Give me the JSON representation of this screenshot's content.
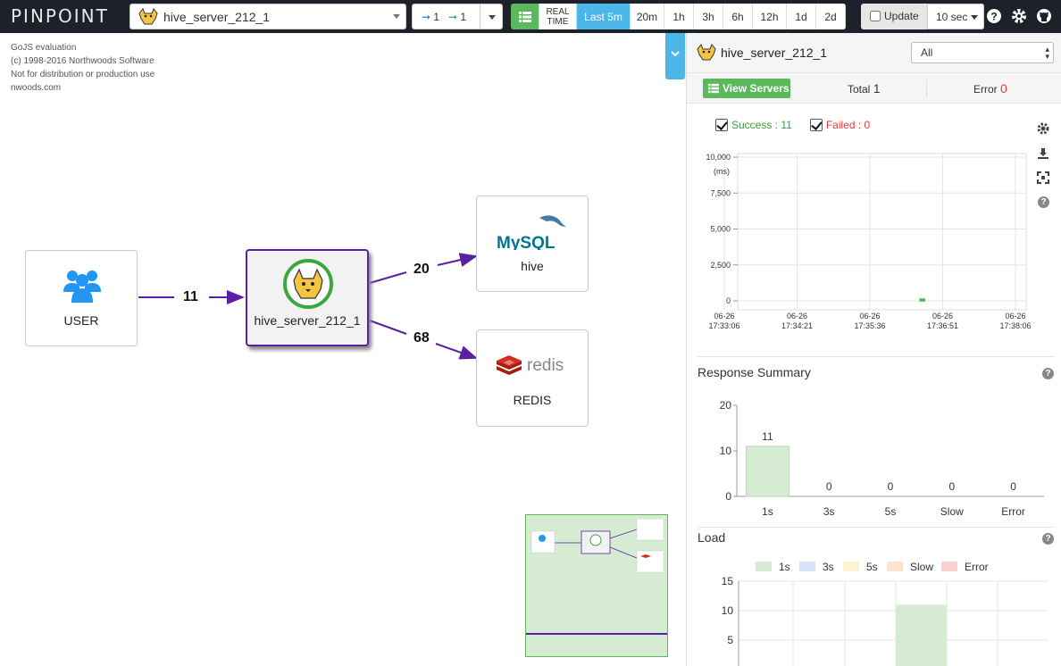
{
  "brand": "PINPOINT",
  "app_selector": {
    "value": "hive_server_212_1"
  },
  "depth": {
    "inbound": "1",
    "outbound": "1"
  },
  "time_range": {
    "real_time": "REAL TIME",
    "options": [
      "Last 5m",
      "20m",
      "1h",
      "3h",
      "6h",
      "12h",
      "1d",
      "2d"
    ],
    "selected": "Last 5m"
  },
  "update": {
    "label": "Update",
    "interval": "10 sec"
  },
  "gojs_notice": [
    "GoJS evaluation",
    "(c) 1998-2016 Northwoods Software",
    "Not for distribution or production use",
    "nwoods.com"
  ],
  "servermap": {
    "nodes": {
      "user": "USER",
      "main": "hive_server_212_1",
      "mysql": "hive",
      "mysql_logo": "MySQL",
      "redis": "REDIS",
      "redis_logo": "redis"
    },
    "edges": {
      "user_to_main": "11",
      "main_to_mysql": "20",
      "main_to_redis": "68"
    }
  },
  "panel": {
    "app_name": "hive_server_212_1",
    "filter": "All",
    "view_servers": "View Servers",
    "total_label": "Total",
    "total_value": "1",
    "error_label": "Error",
    "error_value": "0",
    "scatter": {
      "success_label": "Success : 11",
      "failed_label": "Failed : 0",
      "y_ticks": [
        "10,000",
        "7,500",
        "5,000",
        "2,500",
        "0"
      ],
      "y_unit": "(ms)",
      "x_ticks": [
        [
          "06-26",
          "17:33:06"
        ],
        [
          "06-26",
          "17:34:21"
        ],
        [
          "06-26",
          "17:35:36"
        ],
        [
          "06-26",
          "17:36:51"
        ],
        [
          "06-26",
          "17:38:06"
        ]
      ]
    },
    "response_summary": {
      "title": "Response Summary",
      "categories": [
        "1s",
        "3s",
        "5s",
        "Slow",
        "Error"
      ],
      "values": [
        11,
        0,
        0,
        0,
        0
      ],
      "y_ticks": [
        "20",
        "10",
        "0"
      ]
    },
    "load": {
      "title": "Load",
      "legend": [
        "1s",
        "3s",
        "5s",
        "Slow",
        "Error"
      ],
      "y_ticks": [
        "15",
        "10",
        "5"
      ]
    }
  },
  "chart_data": [
    {
      "type": "scatter",
      "title": "",
      "ylabel": "(ms)",
      "ylim": [
        0,
        10000
      ],
      "x_range": [
        "17:33:06",
        "17:38:06"
      ],
      "series": [
        {
          "name": "Success : 11",
          "points": [
            {
              "x": "17:36:30",
              "y": 0
            }
          ]
        },
        {
          "name": "Failed : 0",
          "points": []
        }
      ]
    },
    {
      "type": "bar",
      "title": "Response Summary",
      "categories": [
        "1s",
        "3s",
        "5s",
        "Slow",
        "Error"
      ],
      "values": [
        11,
        0,
        0,
        0,
        0
      ],
      "ylim": [
        0,
        20
      ]
    },
    {
      "type": "bar",
      "title": "Load",
      "categories": [
        "1s",
        "3s",
        "5s",
        "Slow",
        "Error"
      ],
      "ylim": [
        0,
        15
      ],
      "series": [
        {
          "name": "1s",
          "values": [
            11
          ]
        }
      ]
    }
  ],
  "colors": {
    "accent": "#4db6e8",
    "success": "#5cb85c",
    "edge": "#5b1fa2",
    "error": "#e53935"
  }
}
